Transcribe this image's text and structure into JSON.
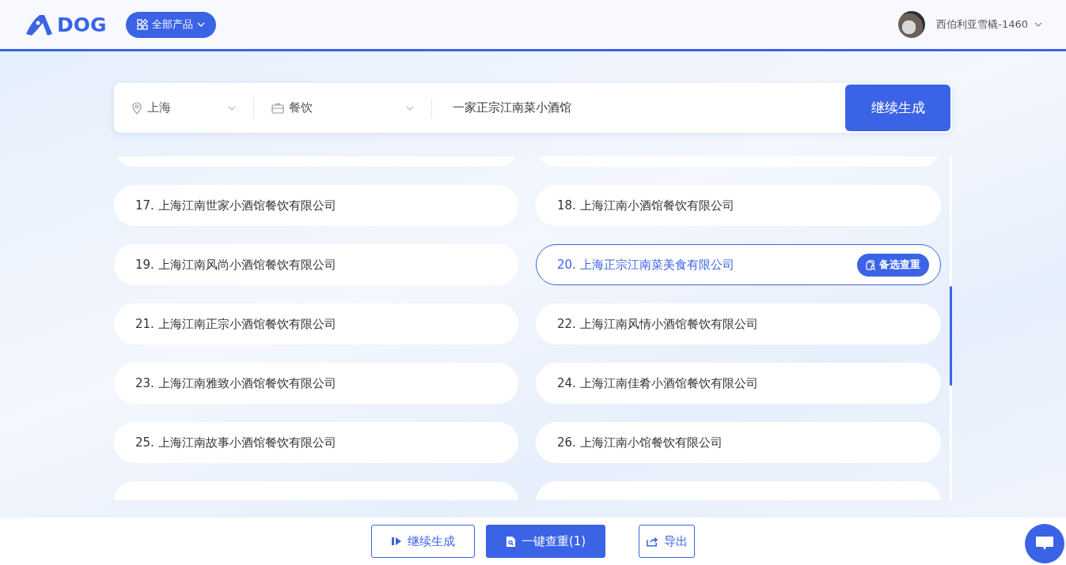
{
  "header": {
    "logo": "DOG",
    "products_button": "全部产品",
    "user": "西伯利亚雪橇-1460"
  },
  "search": {
    "city": "上海",
    "industry": "餐饮",
    "query": "一家正宗江南菜小酒馆",
    "submit": "继续生成"
  },
  "results": [
    {
      "label": "17. 上海江南世家小酒馆餐饮有限公司",
      "selected": false
    },
    {
      "label": "18. 上海江南小酒馆餐饮有限公司",
      "selected": false
    },
    {
      "label": "19. 上海江南风尚小酒馆餐饮有限公司",
      "selected": false
    },
    {
      "label": "20. 上海正宗江南菜美食有限公司",
      "selected": true,
      "action": "备选查重"
    },
    {
      "label": "21. 上海江南正宗小酒馆餐饮有限公司",
      "selected": false
    },
    {
      "label": "22. 上海江南风情小酒馆餐饮有限公司",
      "selected": false
    },
    {
      "label": "23. 上海江南雅致小酒馆餐饮有限公司",
      "selected": false
    },
    {
      "label": "24. 上海江南佳肴小酒馆餐饮有限公司",
      "selected": false
    },
    {
      "label": "25. 上海江南故事小酒馆餐饮有限公司",
      "selected": false
    },
    {
      "label": "26. 上海江南小馆餐饮有限公司",
      "selected": false
    }
  ],
  "footer": [
    {
      "kind": "continue",
      "label": "继续生成"
    },
    {
      "kind": "check",
      "label": "一键查重(1)"
    },
    {
      "kind": "export",
      "label": "导出"
    }
  ]
}
